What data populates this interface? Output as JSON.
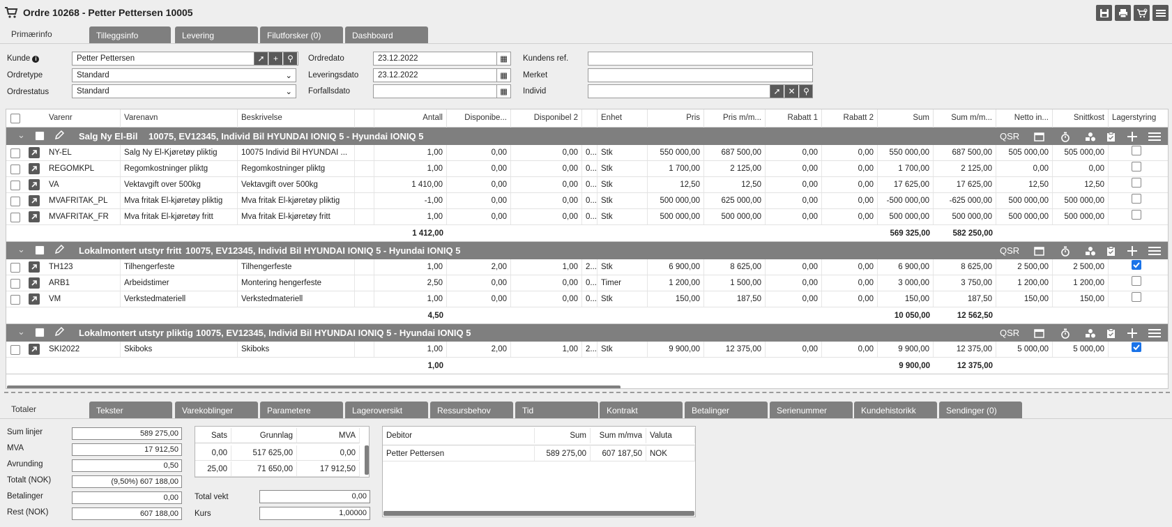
{
  "window": {
    "title": "Ordre 10268 - Petter Pettersen 10005"
  },
  "top_tabs": [
    {
      "label": "Primærinfo"
    },
    {
      "label": "Tilleggsinfo"
    },
    {
      "label": "Levering"
    },
    {
      "label": "Filutforsker (0)"
    },
    {
      "label": "Dashboard"
    }
  ],
  "form": {
    "kunde": {
      "label": "Kunde",
      "value": "Petter Pettersen"
    },
    "ordretype": {
      "label": "Ordretype",
      "value": "Standard"
    },
    "ordrestatus": {
      "label": "Ordrestatus",
      "value": "Standard"
    },
    "ordredato": {
      "label": "Ordredato",
      "value": "23.12.2022"
    },
    "leveringsdato": {
      "label": "Leveringsdato",
      "value": "23.12.2022"
    },
    "forfallsdato": {
      "label": "Forfallsdato",
      "value": ""
    },
    "kundens_ref": {
      "label": "Kundens ref.",
      "value": ""
    },
    "merket": {
      "label": "Merket",
      "value": ""
    },
    "individ": {
      "label": "Individ",
      "value": ""
    }
  },
  "grid": {
    "columns": [
      "Varenr",
      "Varenavn",
      "Beskrivelse",
      "Antall",
      "Disponibe...",
      "Disponibel 2",
      "Enhet",
      "Pris",
      "Pris m/m...",
      "Rabatt 1",
      "Rabatt 2",
      "Sum",
      "Sum m/m...",
      "Netto in...",
      "Snittkost",
      "Lagerstyring"
    ],
    "group_qsr": "QSR",
    "groups": [
      {
        "title": "Salg Ny El-Bil",
        "subtitle": "10075, EV12345, Individ Bil HYUNDAI IONIQ 5 - Hyundai IONIQ 5",
        "rows": [
          {
            "varenr": "NY-EL",
            "varenavn": "Salg Ny El-Kjøretøy pliktig",
            "beskrivelse": "10075 Individ Bil HYUNDAI ...",
            "antall": "1,00",
            "disp1": "0,00",
            "disp2": "0,00",
            "x": "0...",
            "enhet": "Stk",
            "pris": "550 000,00",
            "prismm": "687 500,00",
            "rab1": "0,00",
            "rab2": "0,00",
            "sum": "550 000,00",
            "summm": "687 500,00",
            "netto": "505 000,00",
            "snitt": "505 000,00",
            "lager": false
          },
          {
            "varenr": "REGOMKPL",
            "varenavn": "Regomkostninger pliktg",
            "beskrivelse": "Regomkostninger pliktg",
            "antall": "1,00",
            "disp1": "0,00",
            "disp2": "0,00",
            "x": "0...",
            "enhet": "Stk",
            "pris": "1 700,00",
            "prismm": "2 125,00",
            "rab1": "0,00",
            "rab2": "0,00",
            "sum": "1 700,00",
            "summm": "2 125,00",
            "netto": "0,00",
            "snitt": "0,00",
            "lager": false
          },
          {
            "varenr": "VA",
            "varenavn": "Vektavgift over 500kg",
            "beskrivelse": "Vektavgift over 500kg",
            "antall": "1 410,00",
            "disp1": "0,00",
            "disp2": "0,00",
            "x": "0...",
            "enhet": "Stk",
            "pris": "12,50",
            "prismm": "12,50",
            "rab1": "0,00",
            "rab2": "0,00",
            "sum": "17 625,00",
            "summm": "17 625,00",
            "netto": "12,50",
            "snitt": "12,50",
            "lager": false
          },
          {
            "varenr": "MVAFRITAK_PL",
            "varenavn": "Mva fritak El-kjøretøy pliktig",
            "beskrivelse": "Mva fritak El-kjøretøy pliktig",
            "antall": "-1,00",
            "disp1": "0,00",
            "disp2": "0,00",
            "x": "0...",
            "enhet": "Stk",
            "pris": "500 000,00",
            "prismm": "625 000,00",
            "rab1": "0,00",
            "rab2": "0,00",
            "sum": "-500 000,00",
            "summm": "-625 000,00",
            "netto": "500 000,00",
            "snitt": "500 000,00",
            "lager": false
          },
          {
            "varenr": "MVAFRITAK_FR",
            "varenavn": "Mva fritak El-kjøretøy fritt",
            "beskrivelse": "Mva fritak El-kjøretøy fritt",
            "antall": "1,00",
            "disp1": "0,00",
            "disp2": "0,00",
            "x": "0...",
            "enhet": "Stk",
            "pris": "500 000,00",
            "prismm": "500 000,00",
            "rab1": "0,00",
            "rab2": "0,00",
            "sum": "500 000,00",
            "summm": "500 000,00",
            "netto": "500 000,00",
            "snitt": "500 000,00",
            "lager": false
          }
        ],
        "totals": {
          "antall": "1 412,00",
          "sum": "569 325,00",
          "summm": "582 250,00"
        }
      },
      {
        "title": "Lokalmontert utstyr fritt",
        "subtitle": "10075, EV12345, Individ Bil HYUNDAI IONIQ 5 - Hyundai IONIQ 5",
        "rows": [
          {
            "varenr": "TH123",
            "varenavn": "Tilhengerfeste",
            "beskrivelse": "Tilhengerfeste",
            "antall": "1,00",
            "disp1": "2,00",
            "disp2": "1,00",
            "x": "2...",
            "enhet": "Stk",
            "pris": "6 900,00",
            "prismm": "8 625,00",
            "rab1": "0,00",
            "rab2": "0,00",
            "sum": "6 900,00",
            "summm": "8 625,00",
            "netto": "2 500,00",
            "snitt": "2 500,00",
            "lager": true
          },
          {
            "varenr": "ARB1",
            "varenavn": "Arbeidstimer",
            "beskrivelse": "Montering hengerfeste",
            "antall": "2,50",
            "disp1": "0,00",
            "disp2": "0,00",
            "x": "0...",
            "enhet": "Timer",
            "pris": "1 200,00",
            "prismm": "1 500,00",
            "rab1": "0,00",
            "rab2": "0,00",
            "sum": "3 000,00",
            "summm": "3 750,00",
            "netto": "1 200,00",
            "snitt": "1 200,00",
            "lager": false
          },
          {
            "varenr": "VM",
            "varenavn": "Verkstedmateriell",
            "beskrivelse": "Verkstedmateriell",
            "antall": "1,00",
            "disp1": "0,00",
            "disp2": "0,00",
            "x": "0...",
            "enhet": "Stk",
            "pris": "150,00",
            "prismm": "187,50",
            "rab1": "0,00",
            "rab2": "0,00",
            "sum": "150,00",
            "summm": "187,50",
            "netto": "150,00",
            "snitt": "150,00",
            "lager": false
          }
        ],
        "totals": {
          "antall": "4,50",
          "sum": "10 050,00",
          "summm": "12 562,50"
        }
      },
      {
        "title": "Lokalmontert utstyr pliktig",
        "subtitle": "10075, EV12345, Individ Bil HYUNDAI IONIQ 5 - Hyundai IONIQ 5",
        "rows": [
          {
            "varenr": "SKI2022",
            "varenavn": "Skiboks",
            "beskrivelse": "Skiboks",
            "antall": "1,00",
            "disp1": "2,00",
            "disp2": "1,00",
            "x": "2...",
            "enhet": "Stk",
            "pris": "9 900,00",
            "prismm": "12 375,00",
            "rab1": "0,00",
            "rab2": "0,00",
            "sum": "9 900,00",
            "summm": "12 375,00",
            "netto": "5 000,00",
            "snitt": "5 000,00",
            "lager": true
          }
        ],
        "totals": {
          "antall": "1,00",
          "sum": "9 900,00",
          "summm": "12 375,00"
        }
      }
    ]
  },
  "bottom_tabs": [
    {
      "label": "Totaler"
    },
    {
      "label": "Tekster"
    },
    {
      "label": "Varekoblinger"
    },
    {
      "label": "Parametere"
    },
    {
      "label": "Lageroversikt"
    },
    {
      "label": "Ressursbehov"
    },
    {
      "label": "Tid"
    },
    {
      "label": "Kontrakt"
    },
    {
      "label": "Betalinger"
    },
    {
      "label": "Serienummer"
    },
    {
      "label": "Kundehistorikk"
    },
    {
      "label": "Sendinger (0)"
    }
  ],
  "totals": {
    "sum_linjer": {
      "label": "Sum linjer",
      "value": "589 275,00"
    },
    "mva": {
      "label": "MVA",
      "value": "17 912,50"
    },
    "avrunding": {
      "label": "Avrunding",
      "value": "0,50"
    },
    "totalt": {
      "label": "Totalt (NOK)",
      "value": "(9,50%) 607 188,00"
    },
    "betalinger": {
      "label": "Betalinger",
      "value": "0,00"
    },
    "rest": {
      "label": "Rest (NOK)",
      "value": "607 188,00"
    }
  },
  "vat_table": {
    "headers": [
      "Sats",
      "Grunnlag",
      "MVA"
    ],
    "rows": [
      [
        "0,00",
        "517 625,00",
        "0,00"
      ],
      [
        "25,00",
        "71 650,00",
        "17 912,50"
      ]
    ]
  },
  "weights": {
    "total_vekt": {
      "label": "Total vekt",
      "value": "0,00"
    },
    "kurs": {
      "label": "Kurs",
      "value": "1,00000"
    }
  },
  "debtor_table": {
    "headers": [
      "Debitor",
      "Sum",
      "Sum m/mva",
      "Valuta"
    ],
    "rows": [
      [
        "Petter Pettersen",
        "589 275,00",
        "607 187,50",
        "NOK"
      ]
    ]
  },
  "colors": {
    "header_gray": "#7f7f7f",
    "button_dark": "#595959",
    "check_blue": "#1a73e8"
  }
}
